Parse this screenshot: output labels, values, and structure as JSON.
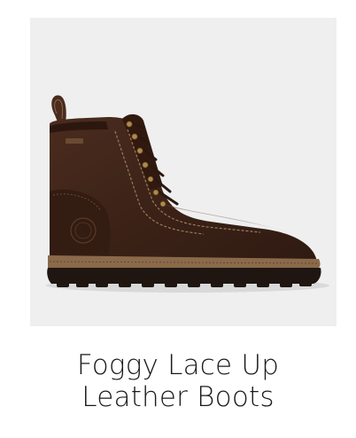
{
  "product": {
    "title_line1": "Foggy Lace Up",
    "title_line2": "Leather Boots",
    "image_background": "#efefef",
    "boot_color": "#3e2418",
    "sole_color": "#1f1612",
    "welt_color": "#8a6a4a",
    "image_icon": "boot-icon"
  }
}
